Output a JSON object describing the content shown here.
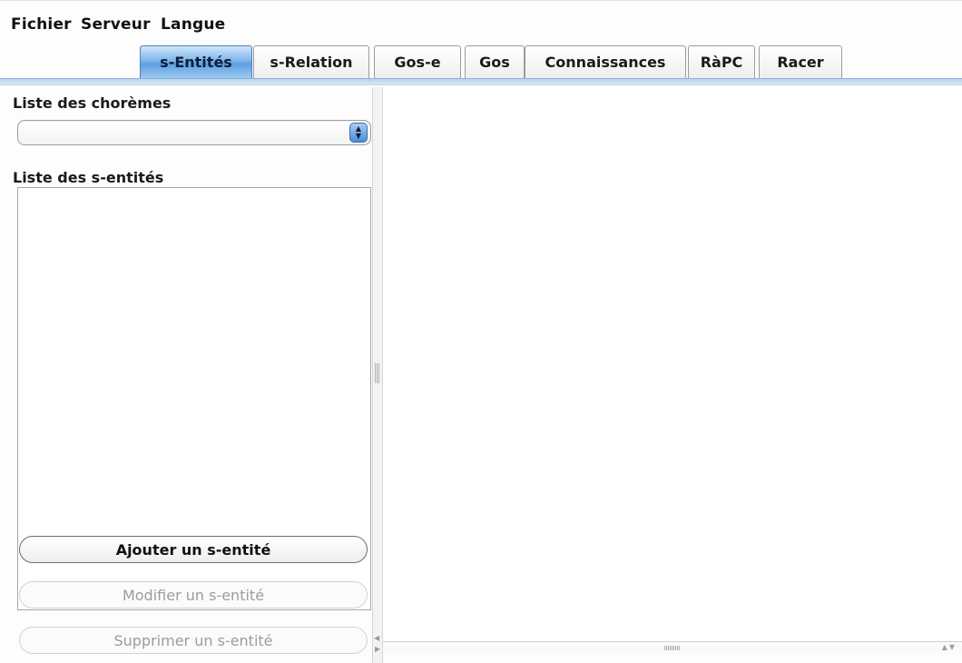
{
  "menubar": {
    "items": [
      "Fichier",
      "Serveur",
      "Langue"
    ]
  },
  "tabs": [
    {
      "label": "s-Entités",
      "active": true
    },
    {
      "label": "s-Relation",
      "active": false
    },
    {
      "label": "Gos-e",
      "active": false
    },
    {
      "label": "Gos",
      "active": false
    },
    {
      "label": "Connaissances",
      "active": false
    },
    {
      "label": "RàPC",
      "active": false
    },
    {
      "label": "Racer",
      "active": false
    }
  ],
  "left_panel": {
    "choremes_label": "Liste des chorèmes",
    "choremes_selected": "",
    "sentites_label": "Liste des s-entités",
    "sentites_items": [],
    "buttons": {
      "add": {
        "label": "Ajouter un s-entité",
        "enabled": true
      },
      "modify": {
        "label": "Modifier un s-entité",
        "enabled": false
      },
      "delete": {
        "label": "Supprimer un s-entité",
        "enabled": false
      }
    }
  },
  "colors": {
    "active_tab": "#5d9fe0",
    "tab_strip": "#b9d4ef",
    "combo_arrow": "#4a8ad8"
  },
  "icons": {
    "combo_arrow": "up-down-arrows-icon",
    "splitter_grip": "grip-icon"
  }
}
